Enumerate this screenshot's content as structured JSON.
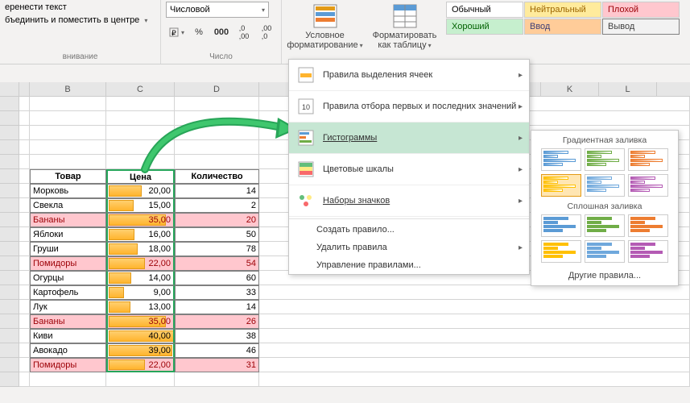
{
  "ribbon": {
    "alignment": {
      "wrap_text": "еренести текст",
      "merge_center": "бъединить и поместить в центре",
      "group_label": "внивание"
    },
    "number": {
      "format": "Числовой",
      "group_label": "Число"
    },
    "styles": {
      "cond_format": "Условное форматирование",
      "format_table": "Форматировать как таблицу",
      "normal": "Обычный",
      "neutral": "Нейтральный",
      "bad": "Плохой",
      "good": "Хороший",
      "input": "Ввод",
      "output": "Вывод"
    }
  },
  "columns": [
    "B",
    "C",
    "D",
    "K",
    "L"
  ],
  "table": {
    "headers": {
      "product": "Товар",
      "price": "Цена",
      "qty": "Количество"
    },
    "rows": [
      {
        "product": "Морковь",
        "price": "20,00",
        "qty": 14,
        "bar": 50,
        "red": false
      },
      {
        "product": "Свекла",
        "price": "15,00",
        "qty": 2,
        "bar": 38,
        "red": false
      },
      {
        "product": "Бананы",
        "price": "35,00",
        "qty": 20,
        "bar": 88,
        "red": true
      },
      {
        "product": "Яблоки",
        "price": "16,00",
        "qty": 50,
        "bar": 40,
        "red": false
      },
      {
        "product": "Груши",
        "price": "18,00",
        "qty": 78,
        "bar": 45,
        "red": false
      },
      {
        "product": "Помидоры",
        "price": "22,00",
        "qty": 54,
        "bar": 55,
        "red": true
      },
      {
        "product": "Огурцы",
        "price": "14,00",
        "qty": 60,
        "bar": 35,
        "red": false
      },
      {
        "product": "Картофель",
        "price": "9,00",
        "qty": 33,
        "bar": 23,
        "red": false
      },
      {
        "product": "Лук",
        "price": "13,00",
        "qty": 14,
        "bar": 33,
        "red": false
      },
      {
        "product": "Бананы",
        "price": "35,00",
        "qty": 26,
        "bar": 88,
        "red": true
      },
      {
        "product": "Киви",
        "price": "40,00",
        "qty": 38,
        "bar": 100,
        "red": false
      },
      {
        "product": "Авокадо",
        "price": "39,00",
        "qty": 46,
        "bar": 98,
        "red": false
      },
      {
        "product": "Помидоры",
        "price": "22,00",
        "qty": 31,
        "bar": 55,
        "red": true
      }
    ]
  },
  "cf_menu": {
    "highlight": "Правила выделения ячеек",
    "top_bottom": "Правила отбора первых и последних значений",
    "data_bars": "Гистограммы",
    "color_scales": "Цветовые шкалы",
    "icon_sets": "Наборы значков",
    "new_rule": "Создать правило...",
    "clear": "Удалить правила",
    "manage": "Управление правилами..."
  },
  "db_panel": {
    "gradient_label": "Градиентная заливка",
    "solid_label": "Сплошная заливка",
    "more": "Другие правила...",
    "gradient_colors": [
      "#5b9bd5",
      "#70ad47",
      "#ed7d31",
      "#ffc000",
      "#6fa8dc",
      "#b45bb4"
    ],
    "solid_colors": [
      "#5b9bd5",
      "#70ad47",
      "#ed7d31",
      "#ffc000",
      "#6fa8dc",
      "#b45bb4"
    ]
  }
}
